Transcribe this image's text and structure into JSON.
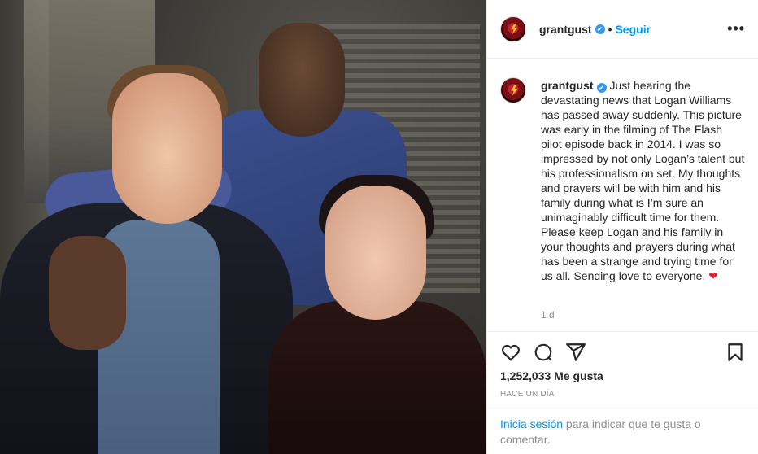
{
  "post": {
    "username": "grantgust",
    "verified_glyph": "✔",
    "dot": "•",
    "follow_label": "Seguir",
    "more_label": "•••",
    "caption": "Just hearing the devastating news that Logan Williams has passed away suddenly. This picture was early in the filming of The Flash pilot episode back in 2014. I was so impressed by not only Logan’s talent but his professionalism on set. My thoughts and prayers will be with him and his family during what is I’m sure an unimaginably difficult time for them. Please keep Logan and his family in your thoughts and prayers during what has been a strange and trying time for us all. Sending love to everyone.",
    "caption_emoji": "❤",
    "age": "1 d",
    "likes": "1,252,033 Me gusta",
    "posted_label": "HACE UN DÍA"
  },
  "actions": {
    "icons": [
      "heart-icon",
      "comment-icon",
      "share-icon",
      "bookmark-icon"
    ]
  },
  "footer": {
    "login_label": "Inicia sesión",
    "rest_text": " para indicar que te gusta o comentar."
  },
  "colors": {
    "accent": "#0095f6",
    "verified": "#3897f0",
    "muted": "#8e8e8e",
    "heart": "#e02438"
  }
}
